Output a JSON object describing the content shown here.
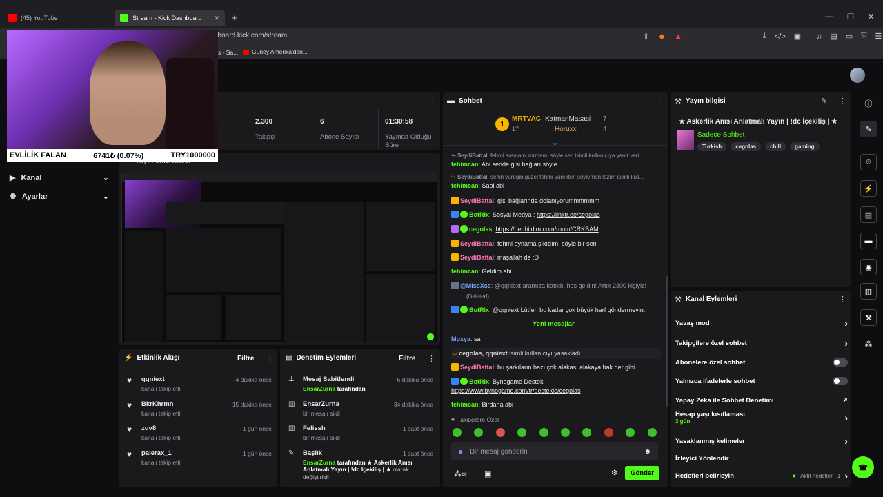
{
  "browser": {
    "tabs": [
      {
        "label": "(45) YouTube"
      },
      {
        "label": "Stream - Kick Dashboard"
      }
    ],
    "new_tab": "+",
    "url": "hboard.kick.com/stream",
    "bookmarks": [
      "s - Sa...",
      "Güney Amerika'dan..."
    ]
  },
  "webcam": {
    "ticker_name": "EVLİLİK FALAN",
    "ticker_value": "6741₺ (0.07%)",
    "ticker_currency": "TRY1000000"
  },
  "stats": [
    {
      "value": "2.300",
      "label": "Takipçi"
    },
    {
      "value": "6",
      "label": "Abone Sayısı"
    },
    {
      "value": "01:30:58",
      "label": "Yayında Olduğu Süre"
    }
  ],
  "sidebar": {
    "items": [
      {
        "label": "Kanal"
      },
      {
        "label": "Ayarlar"
      }
    ],
    "hidden_label": "Yayın önizlemesi"
  },
  "activity": {
    "title": "Etkinlik Akışı",
    "filter": "Filtre",
    "items": [
      {
        "user": "qqniext",
        "action": "kanalı takip etti",
        "time": "4 dakika önce"
      },
      {
        "user": "BkrKhrmn",
        "action": "kanalı takip etti",
        "time": "15 dakika önce"
      },
      {
        "user": "zuv8",
        "action": "kanalı takip etti",
        "time": "1 gün önce"
      },
      {
        "user": "palerax_1",
        "action": "kanalı takip etti",
        "time": "1 gün önce"
      }
    ]
  },
  "moderation": {
    "title": "Denetim Eylemleri",
    "filter": "Filtre",
    "items": [
      {
        "title": "Mesaj Sabitlendi",
        "by": "EnsarZurna",
        "suffix": "tarafından",
        "time": "6 dakika önce"
      },
      {
        "title": "EnsarZurna",
        "desc": "bir mesajı sildi",
        "time": "34 dakika önce"
      },
      {
        "title": "Felissh",
        "desc": "bir mesajı sildi",
        "time": "1 saat önce"
      },
      {
        "title": "Başlık",
        "by": "EnsarZurna",
        "suffix": "tarafından ★ Askerlik Anısı Anlatmalı Yayın | !dc İçekiliş | ★",
        "tail": "olarak değiştirildi",
        "time": "1 saat önce"
      }
    ]
  },
  "chat": {
    "title": "Sohbet",
    "leaderboard": {
      "first_name": "MRTVAC",
      "first_count": "17",
      "rank": "1",
      "second_name": "KatmanMasasi",
      "second_count": "7",
      "third_name": "Horuxx",
      "third_count": "4"
    },
    "messages": [
      {
        "user": "SeydiBattal",
        "text": ": fehmi aramam sormamı söyle sen isimli kullanıcıya yanıt veri...",
        "reply": true
      },
      {
        "user": "fehimcan",
        "text": ": Abi sende gisi bağları söyle"
      },
      {
        "user": "SeydiBattal",
        "text": ": senin yüreğin güzel fehmi yürekten söylemen lazım isimli kull...",
        "reply": true
      },
      {
        "user": "fehimcan",
        "text": ": Saol abi"
      },
      {
        "user": "SeydiBattal",
        "text": ": gisi bağlarında dolanıyorummmmmm"
      },
      {
        "user": "BotRix",
        "text": ": Sosyal Medya : ",
        "link": "https://linktr.ee/cegolas"
      },
      {
        "user": "cegolas",
        "text": ": ",
        "link": "https://benbildim.com/room/CRKBAM"
      },
      {
        "user": "SeydiBattal",
        "text": ": fehmi oynama şıkıdımı söyle bir sen"
      },
      {
        "user": "SeydiBattal",
        "text": ": maşallah de :D"
      },
      {
        "user": "fehimcan",
        "text": ": Geldim abi"
      },
      {
        "user": "@MissXss",
        "text": ": @qqniext aramıza katıldı, hoş geldin! Artık 2300 kişiyiz!"
      },
      {
        "user": "(Deleted)",
        "text": ""
      },
      {
        "user": "BotRix",
        "text": ": @qqniext Lütfen bu kadar çok büyük harf göndermeyin."
      }
    ],
    "new_divider": "Yeni mesajlar",
    "after": [
      {
        "user": "Mpxya",
        "text": ": sa"
      },
      {
        "user": "cegolas, qqniext",
        "text": " isimli kullanıcıyı yasakladı",
        "system": true
      },
      {
        "user": "SeydiBattal",
        "text": ": bu şarkıların bazı çok alakası alakaya bak der gibi"
      },
      {
        "user": "BotRix",
        "text": ": Bynogame Destek",
        "link": "https://www.bynogame.com/tr/destekle/cegolas"
      },
      {
        "user": "fehimcan",
        "text": ": Birdaha abi"
      }
    ],
    "followers_only": "Takipçilere Özel",
    "input_placeholder": "Bir mesaj gönderin",
    "send": "Gönder"
  },
  "stream_info": {
    "title": "Yayın bilgisi",
    "stream_title": "★ Askerlik Anısı Anlatmalı Yayın | !dc İçekiliş | ★",
    "category": "Sadece Sohbet",
    "tags": [
      "Turkish",
      "cegolas",
      "chill",
      "gaming"
    ]
  },
  "channel_actions": {
    "title": "Kanal Eylemleri",
    "items": [
      {
        "label": "Yavaş mod",
        "control": "chevron"
      },
      {
        "label": "Takipçilere özel sohbet",
        "control": "chevron"
      },
      {
        "label": "Abonelere özel sohbet",
        "control": "toggle"
      },
      {
        "label": "Yalnızca ifadelerle sohbet",
        "control": "toggle"
      },
      {
        "label": "Yapay Zeka ile Sohbet Denetimi",
        "control": "external"
      },
      {
        "label": "Hesap yaşı kısıtlaması",
        "sub": "3 gün",
        "control": "chevron"
      },
      {
        "label": "Yasaklanmış kelimeler",
        "control": "chevron"
      },
      {
        "label": "İzleyici Yönlendir",
        "control": "none"
      },
      {
        "label": "Hedefleri belirleyin",
        "extra": "Aktif hedefler - 1",
        "control": "chevron"
      }
    ]
  },
  "colors": {
    "accent": "#53fc18",
    "background": "#0e0e10",
    "panel": "#1a1a1c"
  }
}
